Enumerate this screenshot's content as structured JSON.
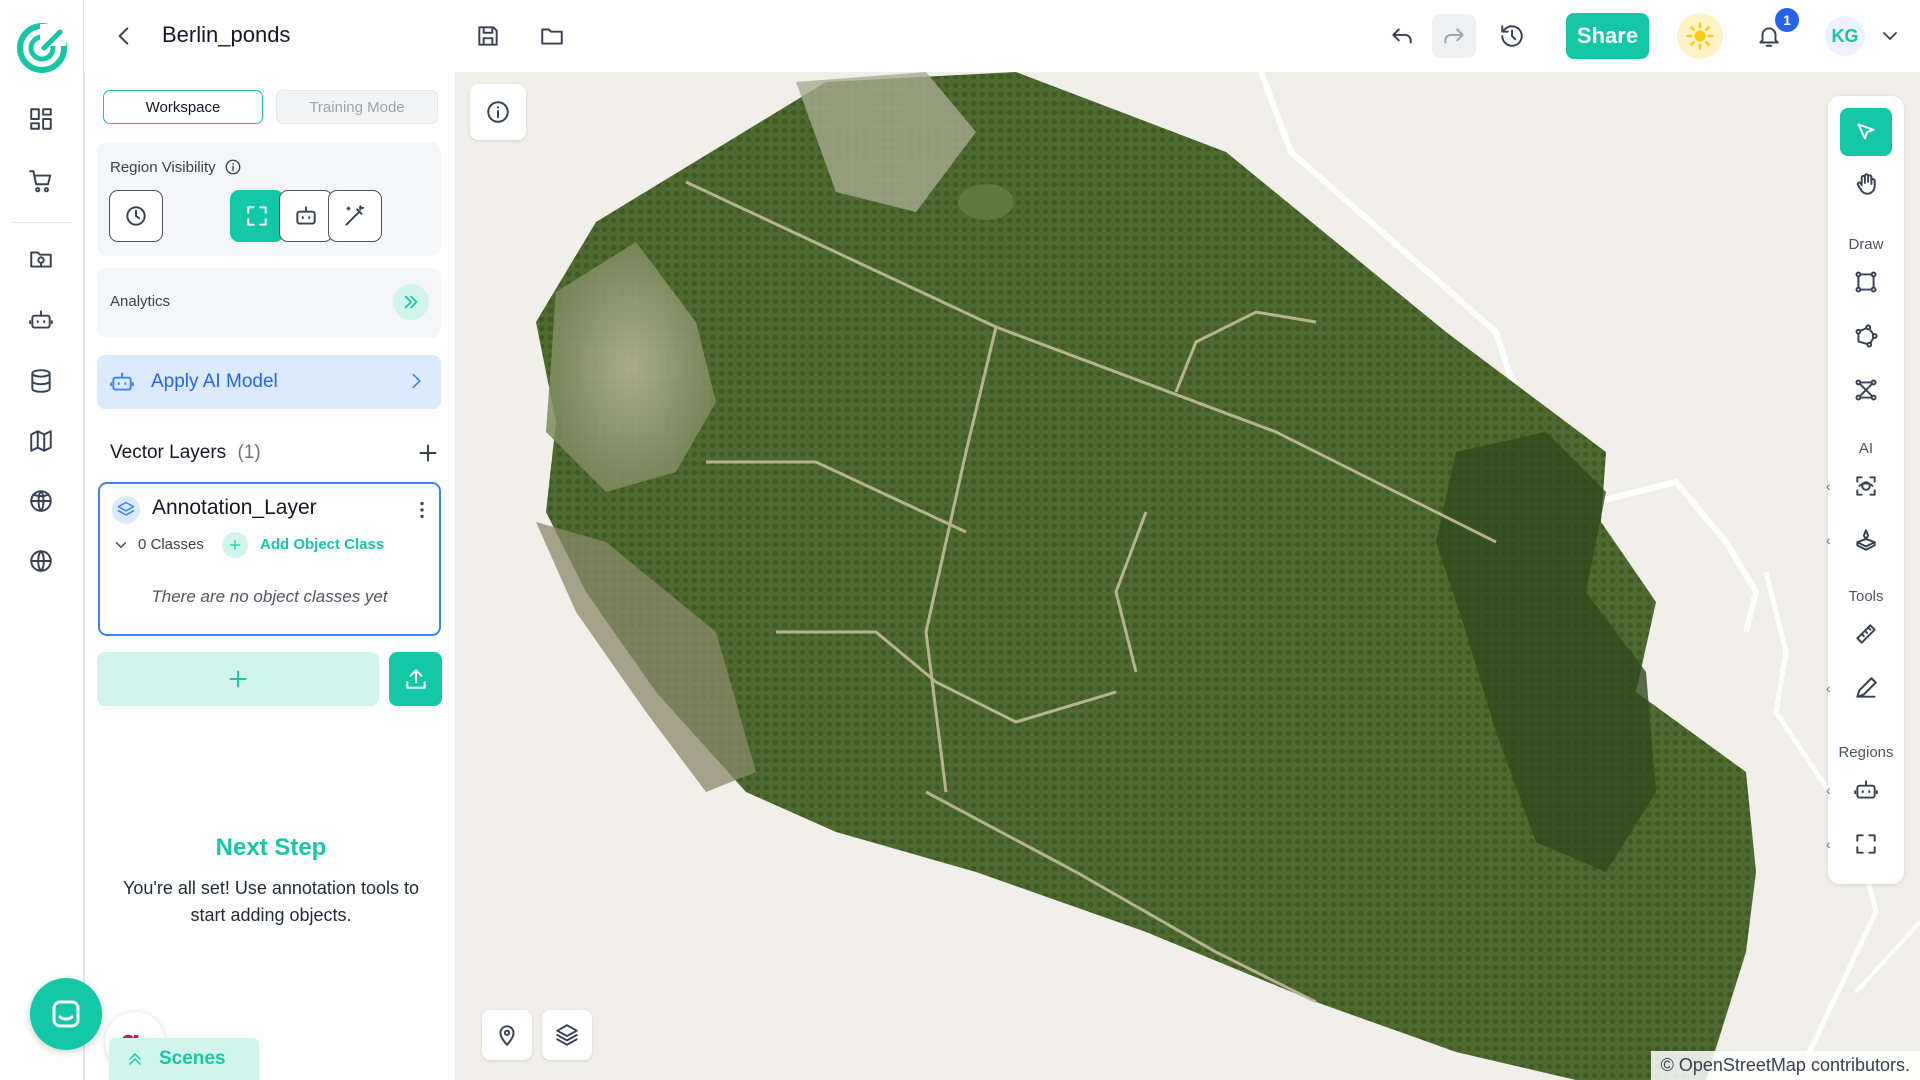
{
  "app": {
    "title": "Berlin_ponds"
  },
  "topbar": {
    "share_label": "Share",
    "notification_count": "1",
    "user_initials": "KG"
  },
  "panel": {
    "tabs": [
      {
        "label": "Workspace",
        "active": true
      },
      {
        "label": "Training Mode",
        "active": false
      }
    ],
    "region_visibility_label": "Region Visibility",
    "analytics_label": "Analytics",
    "apply_ai_label": "Apply AI Model",
    "vector_layers_label": "Vector Layers",
    "vector_layers_count": "(1)",
    "layer": {
      "name": "Annotation_Layer",
      "classes_label": "0 Classes",
      "add_class_label": "Add Object Class",
      "empty_text": "There are no object classes yet"
    },
    "next_step": {
      "title": "Next Step",
      "text": "You're all set! Use annotation tools to start adding objects."
    },
    "scenes_label": "Scenes",
    "grammarly_letter": "g."
  },
  "toolbar": {
    "draw_label": "Draw",
    "ai_label": "AI",
    "tools_label": "Tools",
    "regions_label": "Regions"
  },
  "map": {
    "attribution": "© OpenStreetMap contributors."
  },
  "colors": {
    "accent": "#14c7a6",
    "active_tab_border": "#14c7a6",
    "layer_border": "#3b82f6",
    "badge": "#2563eb"
  }
}
